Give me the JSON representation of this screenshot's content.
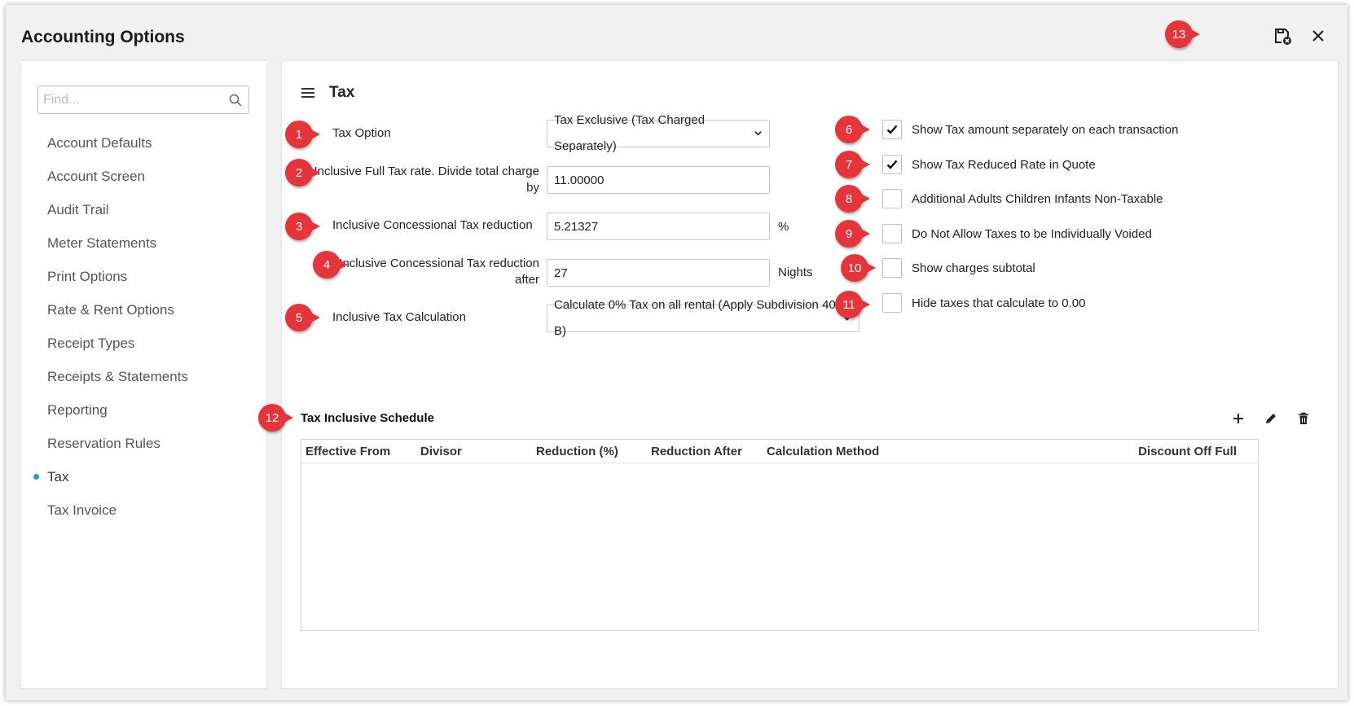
{
  "window": {
    "title": "Accounting Options"
  },
  "colors": {
    "badge": "#e6353a",
    "active_dot": "#1aa3c9"
  },
  "search": {
    "placeholder": "Find..."
  },
  "sidebar": {
    "items": [
      {
        "label": "Account Defaults"
      },
      {
        "label": "Account Screen"
      },
      {
        "label": "Audit Trail"
      },
      {
        "label": "Meter Statements"
      },
      {
        "label": "Print Options"
      },
      {
        "label": "Rate & Rent Options"
      },
      {
        "label": "Receipt Types"
      },
      {
        "label": "Receipts & Statements"
      },
      {
        "label": "Reporting"
      },
      {
        "label": "Reservation Rules"
      },
      {
        "label": "Tax"
      },
      {
        "label": "Tax Invoice"
      }
    ],
    "active": "Tax"
  },
  "main": {
    "title": "Tax",
    "form": {
      "tax_option": {
        "label": "Tax Option",
        "value": "Tax Exclusive (Tax Charged Separately)"
      },
      "full_tax_rate": {
        "label_line1": "Inclusive Full Tax rate. Divide total charge",
        "label_line2": "by",
        "value": "11.00000"
      },
      "concessional_reduction": {
        "label": "Inclusive Concessional Tax reduction",
        "value": "5.21327",
        "suffix": "%"
      },
      "concessional_after": {
        "label_line1": "Inclusive Concessional Tax reduction",
        "label_line2": "after",
        "value": "27",
        "suffix": "Nights"
      },
      "tax_calculation": {
        "label": "Inclusive Tax Calculation",
        "value": "Calculate 0% Tax on all rental (Apply Subdivision 40-B)"
      }
    },
    "checkboxes": [
      {
        "label": "Show Tax amount separately on each transaction",
        "checked": true
      },
      {
        "label": "Show Tax Reduced Rate in Quote",
        "checked": true
      },
      {
        "label": "Additional Adults Children Infants Non-Taxable",
        "checked": false
      },
      {
        "label": "Do Not Allow Taxes to be Individually Voided",
        "checked": false
      },
      {
        "label": "Show charges subtotal",
        "checked": false
      },
      {
        "label": "Hide taxes that calculate to 0.00",
        "checked": false
      }
    ],
    "schedule": {
      "title": "Tax Inclusive Schedule",
      "columns": [
        "Effective From",
        "Divisor",
        "Reduction (%)",
        "Reduction After",
        "Calculation Method",
        "Discount Off Full"
      ]
    }
  },
  "badges": [
    "1",
    "2",
    "3",
    "4",
    "5",
    "6",
    "7",
    "8",
    "9",
    "10",
    "11",
    "12",
    "13"
  ]
}
